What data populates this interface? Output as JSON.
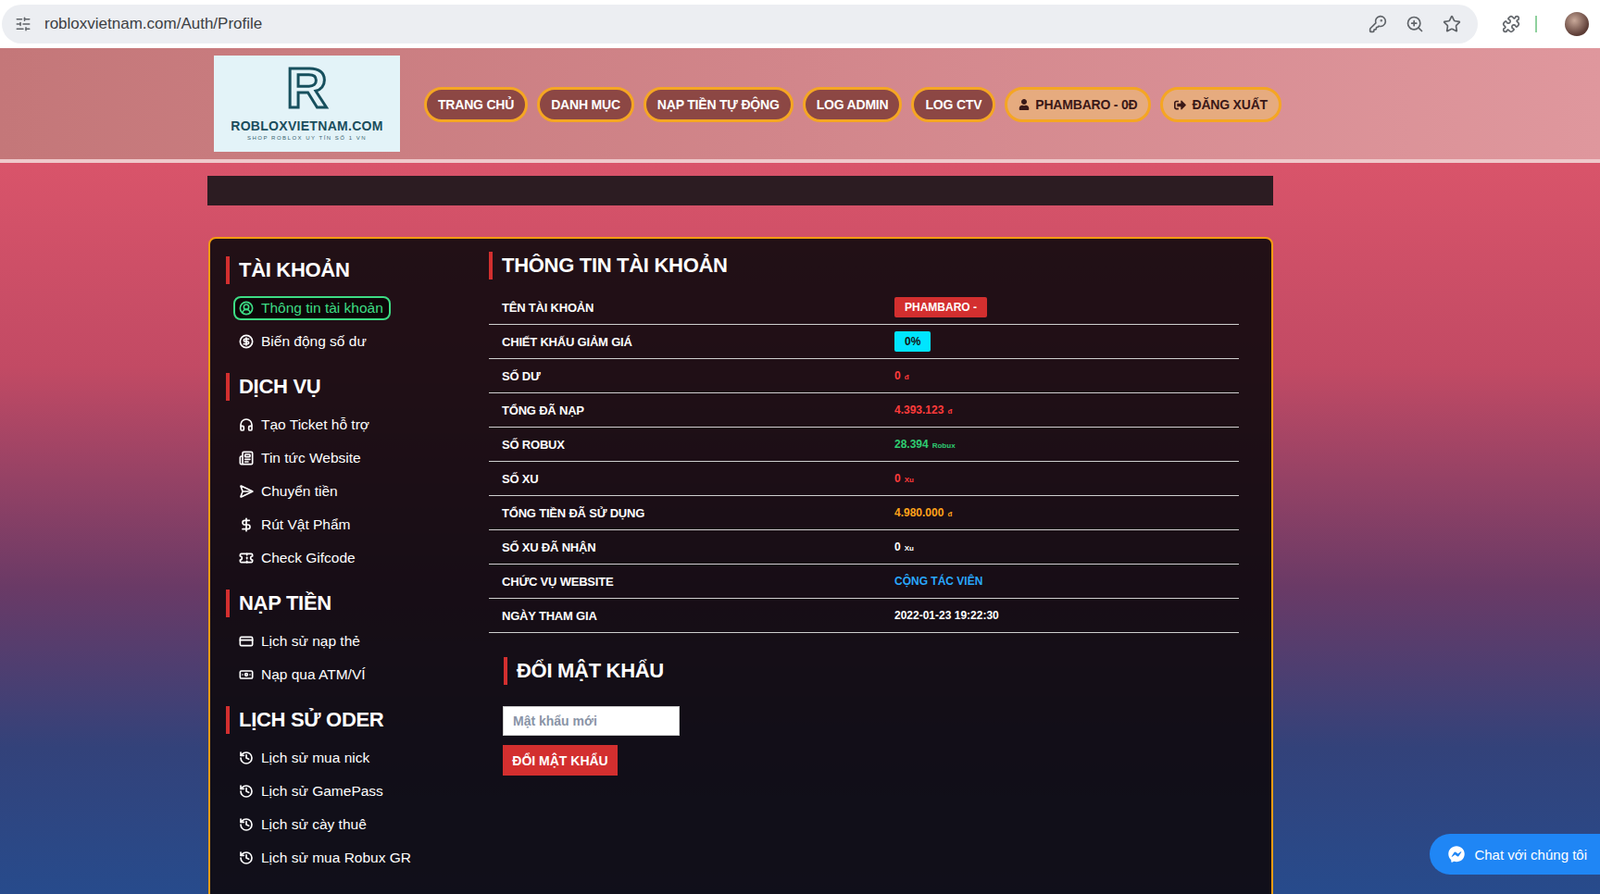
{
  "browser": {
    "url": "robloxvietnam.com/Auth/Profile"
  },
  "logo": {
    "mark": "R",
    "name": "ROBLOXVIETNAM.COM",
    "tagline": "SHOP ROBLOX UY TÍN SỐ 1 VN"
  },
  "nav": [
    {
      "label": "TRANG CHỦ",
      "highlighted": false,
      "kind": "link"
    },
    {
      "label": "DANH MỤC",
      "highlighted": false,
      "kind": "link"
    },
    {
      "label": "NẠP TIỀN TỰ ĐỘNG",
      "highlighted": false,
      "kind": "link"
    },
    {
      "label": "LOG ADMIN",
      "highlighted": false,
      "kind": "link"
    },
    {
      "label": "LOG CTV",
      "highlighted": false,
      "kind": "link"
    },
    {
      "label": "PHAMBARO - 0Đ",
      "highlighted": true,
      "kind": "user"
    },
    {
      "label": "ĐĂNG XUẤT",
      "highlighted": true,
      "kind": "logout"
    }
  ],
  "sidebar": [
    {
      "title": "TÀI KHOẢN",
      "items": [
        {
          "label": "Thông tin tài khoản",
          "selected": true
        },
        {
          "label": "Biến động số dư",
          "selected": false
        }
      ]
    },
    {
      "title": "DỊCH VỤ",
      "items": [
        {
          "label": "Tạo Ticket hỗ trợ",
          "selected": false
        },
        {
          "label": "Tin tức Website",
          "selected": false
        },
        {
          "label": "Chuyển tiền",
          "selected": false
        },
        {
          "label": "Rút Vật Phẩm",
          "selected": false
        },
        {
          "label": "Check Gifcode",
          "selected": false
        }
      ]
    },
    {
      "title": "NẠP TIỀN",
      "items": [
        {
          "label": "Lịch sử nạp thẻ",
          "selected": false
        },
        {
          "label": "Nạp qua ATM/VÍ",
          "selected": false
        }
      ]
    },
    {
      "title": "LỊCH SỬ ODER",
      "items": [
        {
          "label": "Lịch sử mua nick",
          "selected": false
        },
        {
          "label": "Lịch sử GamePass",
          "selected": false
        },
        {
          "label": "Lịch sử cày thuê",
          "selected": false
        },
        {
          "label": "Lịch sử mua Robux GR",
          "selected": false
        }
      ]
    }
  ],
  "account": {
    "title": "THÔNG TIN TÀI KHOẢN",
    "rows": [
      {
        "label": "TÊN TÀI KHOẢN",
        "value": "PHAMBARO -",
        "kind": "badge",
        "color": "#d32f2f"
      },
      {
        "label": "CHIẾT KHẤU GIẢM GIÁ",
        "value": "0%",
        "kind": "badge",
        "color": "#00e5ff"
      },
      {
        "label": "SỐ DƯ",
        "value": "0",
        "unit": "đ",
        "kind": "amount",
        "color": "#ff3b3b"
      },
      {
        "label": "TỔNG ĐÃ NẠP",
        "value": "4.393.123",
        "unit": "đ",
        "kind": "amount",
        "color": "#ff3b3b"
      },
      {
        "label": "SỐ ROBUX",
        "value": "28.394",
        "unit": "Robux",
        "kind": "amount",
        "color": "#2ecc71"
      },
      {
        "label": "SỐ XU",
        "value": "0",
        "unit": "Xu",
        "kind": "amount",
        "color": "#ff3b3b"
      },
      {
        "label": "TỔNG TIỀN ĐÃ SỬ DỤNG",
        "value": "4.980.000",
        "unit": "đ",
        "kind": "amount",
        "color": "#ffa31a"
      },
      {
        "label": "SỐ XU ĐÃ NHẬN",
        "value": "0",
        "unit": "Xu",
        "kind": "amount",
        "color": "#ffffff"
      },
      {
        "label": "CHỨC VỤ WEBSITE",
        "value": "CỘNG TÁC VIÊN",
        "kind": "text",
        "color": "#29a8ff"
      },
      {
        "label": "NGÀY THAM GIA",
        "value": "2022-01-23 19:22:30",
        "kind": "text",
        "color": "#ffffff"
      }
    ]
  },
  "password": {
    "title": "ĐỔI MẬT KHẨU",
    "placeholder": "Mật khẩu mới",
    "button": "ĐỔI MẬT KHẨU"
  },
  "chat": {
    "label": "Chat với chúng tôi"
  }
}
